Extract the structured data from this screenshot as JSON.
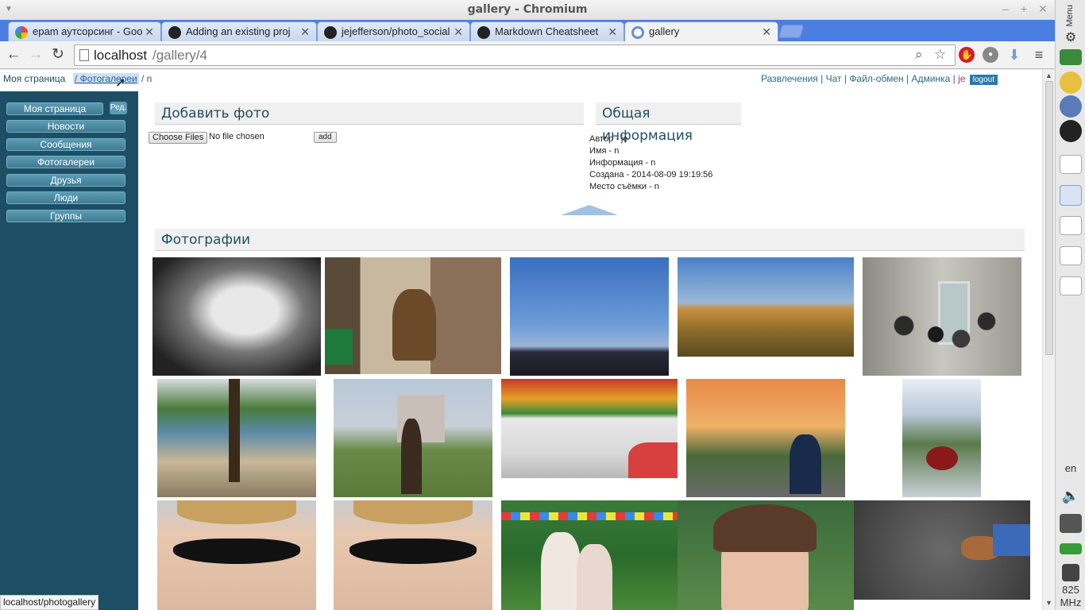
{
  "window": {
    "title": "gallery - Chromium"
  },
  "tabs": [
    {
      "label": "epam аутсорсинг - Goo",
      "icon": "google-icon"
    },
    {
      "label": "Adding an existing proj",
      "icon": "github-icon"
    },
    {
      "label": "jejefferson/photo_social",
      "icon": "github-icon"
    },
    {
      "label": "Markdown Cheatsheet",
      "icon": "github-icon"
    },
    {
      "label": "gallery",
      "icon": "chromium-icon",
      "active": true
    }
  ],
  "toolbar": {
    "url_host": "localhost",
    "url_path": "/gallery/4"
  },
  "crumbs": {
    "home": "Моя страница",
    "galleries": "/ Фотогалереи",
    "current": "/ n"
  },
  "topnav": {
    "items": [
      "Развлечения",
      "Чат",
      "Файл-обмен",
      "Админка"
    ],
    "user": "je",
    "logout": "logout"
  },
  "sidebar": {
    "edit": "Ред.",
    "items": [
      "Моя страница",
      "Новости",
      "Сообщения",
      "Фотогалереи",
      "Друзья",
      "Люди",
      "Группы"
    ]
  },
  "upload": {
    "title": "Добавить фото",
    "choose": "Choose Files",
    "file_state": "No file chosen",
    "add": "add"
  },
  "info": {
    "title": "Общая информация",
    "lines": [
      "Автор - je",
      "Имя - n",
      "Информация - n",
      "Создана - 2014-08-09 19:19:56",
      "Место съёмки - n"
    ]
  },
  "photos": {
    "title": "Фотографии"
  },
  "status": {
    "text": "localhost/photogallery"
  },
  "desktop": {
    "menu": "Menu",
    "lang": "en",
    "freq": "825",
    "freq_unit": "MHz"
  },
  "colors": {
    "sidebar": "#1e4e64",
    "button": "#4a8aa2",
    "tabstrip": "#4a7ee0",
    "heading": "#1f4d66"
  }
}
